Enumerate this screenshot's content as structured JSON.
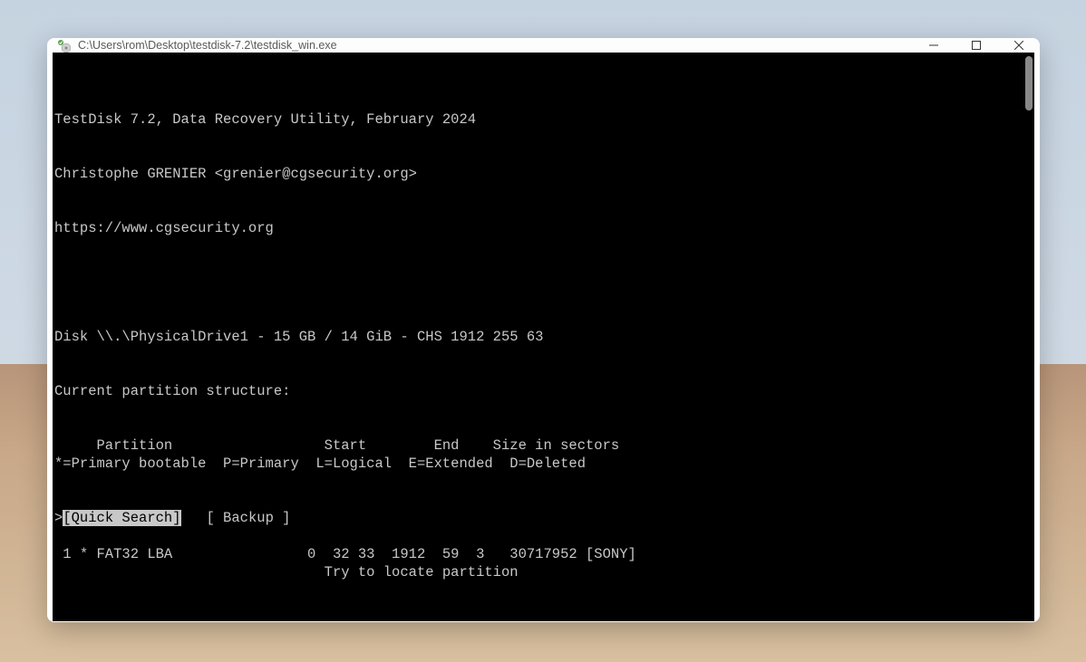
{
  "window": {
    "title": "C:\\Users\\rom\\Desktop\\testdisk-7.2\\testdisk_win.exe"
  },
  "terminal": {
    "header1": "TestDisk 7.2, Data Recovery Utility, February 2024",
    "header2": "Christophe GRENIER <grenier@cgsecurity.org>",
    "header3": "https://www.cgsecurity.org",
    "diskline": "Disk \\\\.\\PhysicalDrive1 - 15 GB / 14 GiB - CHS 1912 255 63",
    "structline": "Current partition structure:",
    "tableheader": "     Partition                  Start        End    Size in sectors",
    "partition1": " 1 * FAT32 LBA                0  32 33  1912  59  3   30717952 [SONY]",
    "legend": "*=Primary bootable  P=Primary  L=Logical  E=Extended  D=Deleted",
    "prompt": ">",
    "option1": "[Quick Search]",
    "spacer": "   ",
    "option2": "[ Backup ]",
    "hint": "                                Try to locate partition"
  }
}
